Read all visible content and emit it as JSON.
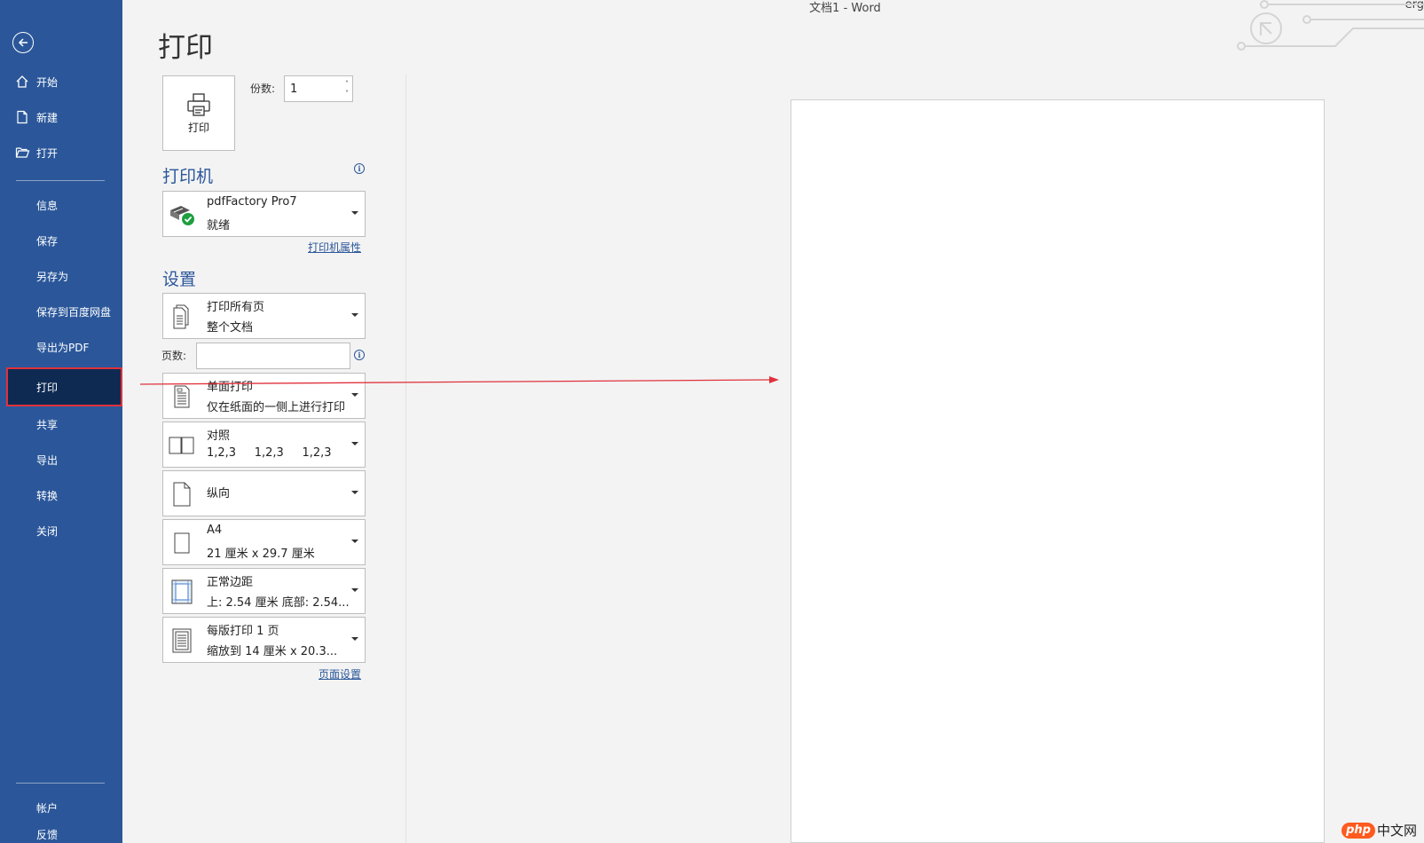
{
  "window": {
    "title": "文档1  -  Word",
    "user": "erg"
  },
  "sidebar": {
    "items": [
      {
        "label": "开始",
        "icon": "home-icon"
      },
      {
        "label": "新建",
        "icon": "new-document-icon"
      },
      {
        "label": "打开",
        "icon": "folder-open-icon"
      },
      {
        "label": "信息"
      },
      {
        "label": "保存"
      },
      {
        "label": "另存为"
      },
      {
        "label": "保存到百度网盘"
      },
      {
        "label": "导出为PDF"
      },
      {
        "label": "打印",
        "active": true
      },
      {
        "label": "共享"
      },
      {
        "label": "导出"
      },
      {
        "label": "转换"
      },
      {
        "label": "关闭"
      },
      {
        "label": "帐户"
      },
      {
        "label": "反馈"
      }
    ]
  },
  "main": {
    "title": "打印",
    "print_button_label": "打印",
    "copies_label": "份数:",
    "copies_value": "1",
    "printer": {
      "heading": "打印机",
      "name": "pdfFactory Pro7",
      "status": "就绪",
      "properties_link": "打印机属性"
    },
    "settings": {
      "heading": "设置",
      "range": {
        "line1": "打印所有页",
        "line2": "整个文档"
      },
      "pages_label": "页数:",
      "pages_value": "",
      "sides": {
        "line1": "单面打印",
        "line2": "仅在纸面的一侧上进行打印"
      },
      "collate": {
        "line1": "对照",
        "line2": "1,2,3     1,2,3     1,2,3"
      },
      "orientation": {
        "line1": "纵向"
      },
      "paper": {
        "line1": "A4",
        "line2": "21 厘米 x 29.7 厘米"
      },
      "margins": {
        "line1": "正常边距",
        "line2": "上: 2.54 厘米 底部: 2.54..."
      },
      "per_sheet": {
        "line1": "每版打印 1 页",
        "line2": "缩放到 14 厘米 x 20.3..."
      },
      "page_setup_link": "页面设置"
    }
  },
  "watermark": {
    "brand": "php",
    "text": "中文网"
  },
  "colors": {
    "sidebar": "#2b579a",
    "active": "#0f2a52",
    "highlight": "#e0313b",
    "accent": "#2b579a"
  }
}
